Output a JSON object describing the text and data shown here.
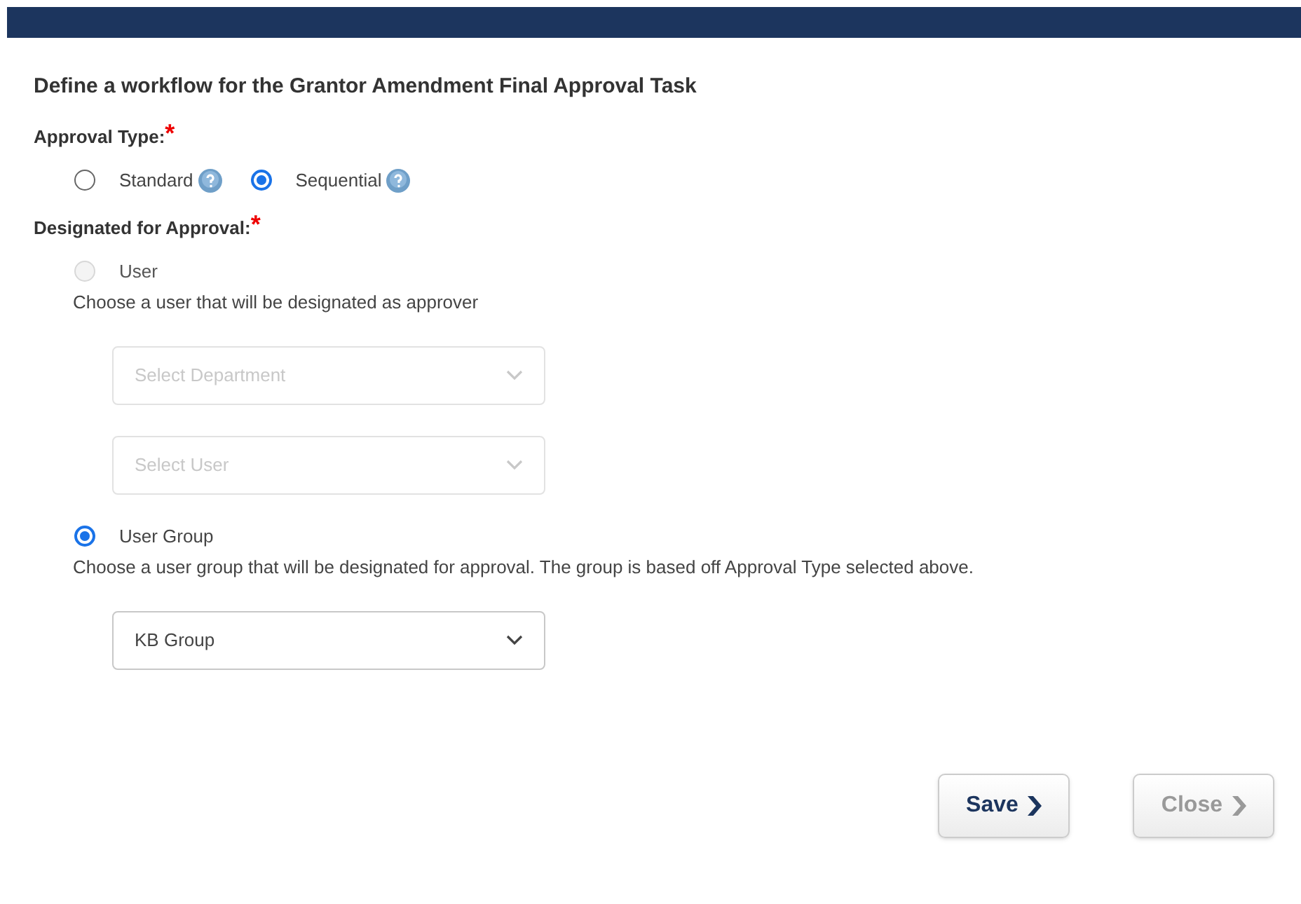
{
  "title": "Define a workflow for the Grantor Amendment Final Approval Task",
  "approval_type": {
    "label": "Approval Type:",
    "required_mark": "*",
    "options": [
      {
        "label": "Standard",
        "selected": false
      },
      {
        "label": "Sequential",
        "selected": true
      }
    ]
  },
  "designated": {
    "label": "Designated for Approval:",
    "required_mark": "*",
    "options": [
      {
        "label": "User",
        "selected": false,
        "disabled": true,
        "description": "Choose a user that will be designated as approver",
        "selects": [
          {
            "placeholder": "Select Department",
            "disabled": true
          },
          {
            "placeholder": "Select User",
            "disabled": true
          }
        ]
      },
      {
        "label": "User Group",
        "selected": true,
        "disabled": false,
        "description": "Choose a user group that will be designated for approval. The group is based off Approval Type selected above.",
        "selects": [
          {
            "value": "KB Group",
            "disabled": false
          }
        ]
      }
    ]
  },
  "buttons": [
    {
      "label": "Save",
      "disabled": false
    },
    {
      "label": "Close",
      "disabled": true
    }
  ]
}
